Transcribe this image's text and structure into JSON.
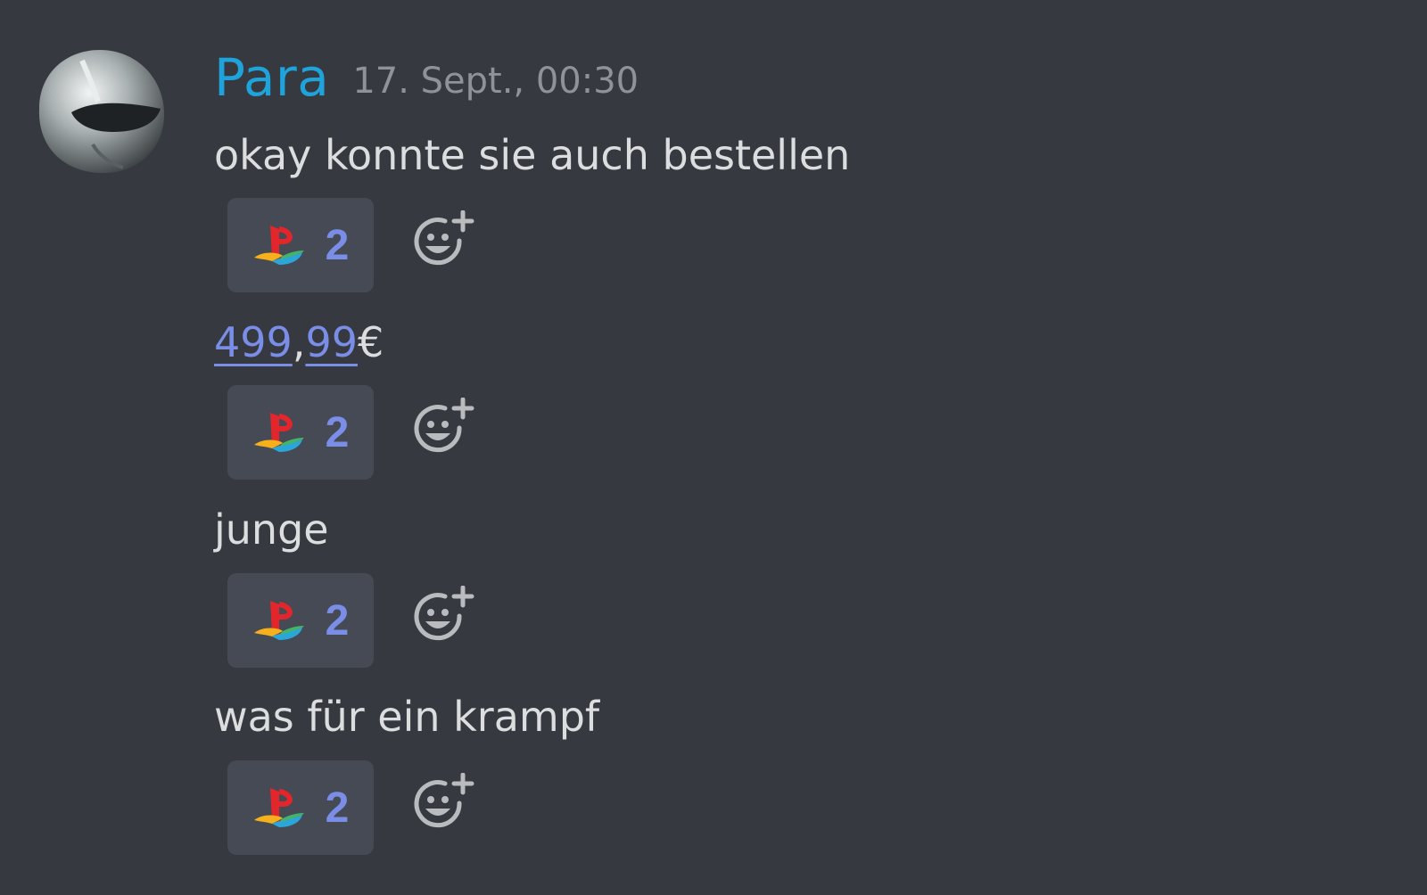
{
  "message": {
    "author": "Para",
    "timestamp": "17. Sept., 00:30"
  },
  "lines": [
    {
      "text": "okay konnte sie auch bestellen"
    },
    {
      "price": {
        "part1": "499",
        "sep": ",",
        "part2": "99",
        "suffix": "€"
      }
    },
    {
      "text": "junge"
    },
    {
      "text": "was für ein krampf"
    }
  ],
  "reactions": [
    {
      "emoji": "playstation-logo",
      "count": "2"
    },
    {
      "emoji": "playstation-logo",
      "count": "2"
    },
    {
      "emoji": "playstation-logo",
      "count": "2"
    },
    {
      "emoji": "playstation-logo",
      "count": "2"
    }
  ],
  "colors": {
    "background": "#36393f",
    "username": "#1fa3db",
    "timestamp": "#8f9296",
    "text": "#dcddde",
    "link": "#7a8ee8",
    "reaction_bg": "#454a54",
    "icon": "#b9bbbe"
  }
}
